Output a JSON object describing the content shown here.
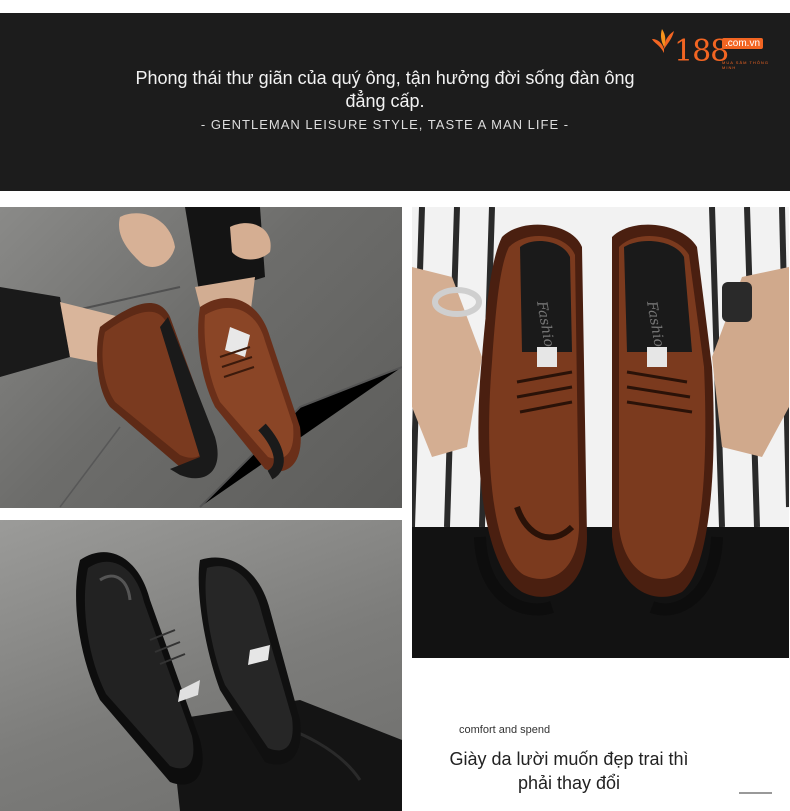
{
  "banner": {
    "headline": "Phong thái thư giãn của quý ông, tận hưởng đời sống đàn ông đẳng cấp.",
    "subline": "- GENTLEMAN LEISURE STYLE, TASTE A MAN LIFE -"
  },
  "logo": {
    "number": "188",
    "domain": ".com.vn",
    "tagline": "MUA SẮM THÔNG MINH",
    "color": "#f26522"
  },
  "product": {
    "embossed_text": "Fashio"
  },
  "caption": {
    "small": "comfort and spend",
    "main": "Giày da lười muốn đẹp trai thì phải thay đổi"
  },
  "colors": {
    "banner_bg": "#1c1c1c",
    "brown_leather": "#6b2e17",
    "black_leather": "#151515"
  }
}
